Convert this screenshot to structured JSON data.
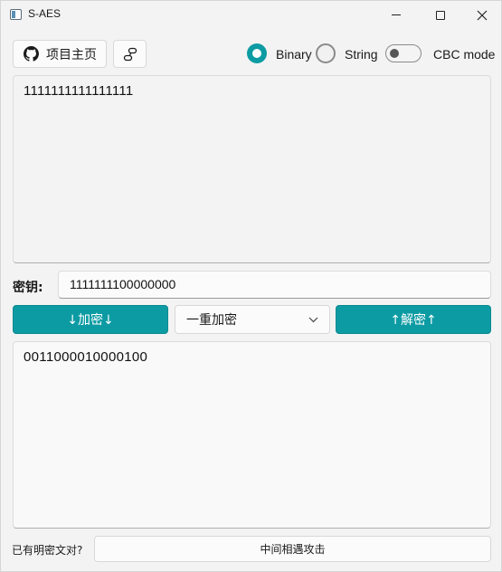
{
  "window": {
    "title": "S-AES",
    "controls": {
      "minimize": "minimize",
      "maximize": "maximize",
      "close": "close"
    }
  },
  "toolbar": {
    "home_button_label": "项目主页",
    "home_icon": "github-icon",
    "link_icon": "link-icon",
    "mode_options": [
      {
        "label": "Binary",
        "selected": true
      },
      {
        "label": "String",
        "selected": false
      }
    ],
    "cbc_toggle": {
      "label": "CBC mode",
      "on": false
    }
  },
  "input": {
    "value": "1111111111111111"
  },
  "key": {
    "label": "密钥:",
    "value": "1111111100000000"
  },
  "actions": {
    "encrypt_label": "↓加密↓",
    "decrypt_label": "↑解密↑",
    "mode_select": {
      "value": "一重加密"
    }
  },
  "output": {
    "value": "0011000010000100"
  },
  "footer": {
    "question_label": "已有明密文对?",
    "attack_button_label": "中间相遇攻击"
  },
  "colors": {
    "accent": "#0c9ba3",
    "window_bg": "#f3f3f3"
  }
}
